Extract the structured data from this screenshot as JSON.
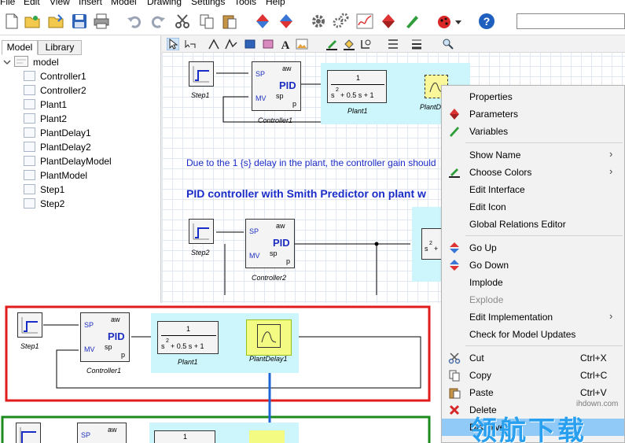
{
  "menubar": [
    "File",
    "Edit",
    "View",
    "Insert",
    "Model",
    "Drawing",
    "Settings",
    "Tools",
    "Help"
  ],
  "left_panel": {
    "tabs": [
      "Model",
      "Library"
    ],
    "root": "model",
    "items": [
      "Controller1",
      "Controller2",
      "Plant1",
      "Plant2",
      "PlantDelay1",
      "PlantDelay2",
      "PlantDelayModel",
      "PlantModel",
      "Step1",
      "Step2"
    ]
  },
  "canvas": {
    "blocks_top": {
      "step": "Step1",
      "controller": "Controller1",
      "plant": "Plant1",
      "plant_delay": "PlantD"
    },
    "note": "Due to the 1 {s} delay in the plant, the controller gain should",
    "heading": "PID controller with Smith Predictor on plant w",
    "blocks_mid": {
      "step": "Step2",
      "controller": "Controller2"
    },
    "pid": {
      "sp": "SP",
      "mv": "MV",
      "aw": "aw",
      "spl": "sp",
      "p": "p",
      "name": "PID"
    },
    "tf": {
      "num": "1",
      "den_s": "s",
      "den_exp": "2",
      "den_rest": "+   0.5 s  +   1"
    },
    "tf_partial": {
      "s": "s",
      "exp": "2",
      "plus": "+"
    }
  },
  "zoom_panel": {
    "step": "Step1",
    "controller": "Controller1",
    "plant": "Plant1",
    "plant_delay": "PlantDelay1",
    "sp": "SP",
    "mv": "MV",
    "aw": "aw",
    "spl": "sp",
    "p": "p",
    "pid": "PID",
    "num": "1",
    "den_s": "s",
    "den_exp": "2",
    "den_rest": "+   0.5 s  +   1",
    "lower_sp": "SP",
    "lower_aw": "aw",
    "lower_num": "1"
  },
  "context_menu": [
    {
      "label": "Properties",
      "icon": ""
    },
    {
      "label": "Parameters",
      "icon": "parameters-icon"
    },
    {
      "label": "Variables",
      "icon": "variables-icon"
    },
    {
      "label": "Show Name",
      "arrow": ">"
    },
    {
      "label": "Choose Colors",
      "icon": "choose-colors-icon",
      "arrow": ">"
    },
    {
      "label": "Edit Interface"
    },
    {
      "label": "Edit Icon"
    },
    {
      "label": "Global Relations Editor"
    },
    {
      "label": "Go Up",
      "icon": "go-up-icon"
    },
    {
      "label": "Go Down",
      "icon": "go-down-icon"
    },
    {
      "label": "Implode"
    },
    {
      "label": "Explode",
      "disabled": true
    },
    {
      "label": "Edit Implementation",
      "arrow": ">"
    },
    {
      "label": "Check for Model Updates"
    },
    {
      "label": "Cut",
      "shortcut": "Ctrl+X",
      "icon": "cut-icon"
    },
    {
      "label": "Copy",
      "shortcut": "Ctrl+C",
      "icon": "copy-icon"
    },
    {
      "label": "Paste",
      "shortcut": "Ctrl+V",
      "icon": "paste-icon"
    },
    {
      "label": "Delete",
      "icon": "delete-icon"
    },
    {
      "label": "Dissolve",
      "highlighted": true
    }
  ],
  "watermark": {
    "url": "ihdown.com",
    "text": "领航下载"
  },
  "colors": {
    "red_frame": "#e21c1c",
    "green_frame": "#1d8a1d",
    "cyan": "#ccf6fb",
    "highlight": "#91c9f7",
    "blue_text": "#1a2cc8"
  }
}
